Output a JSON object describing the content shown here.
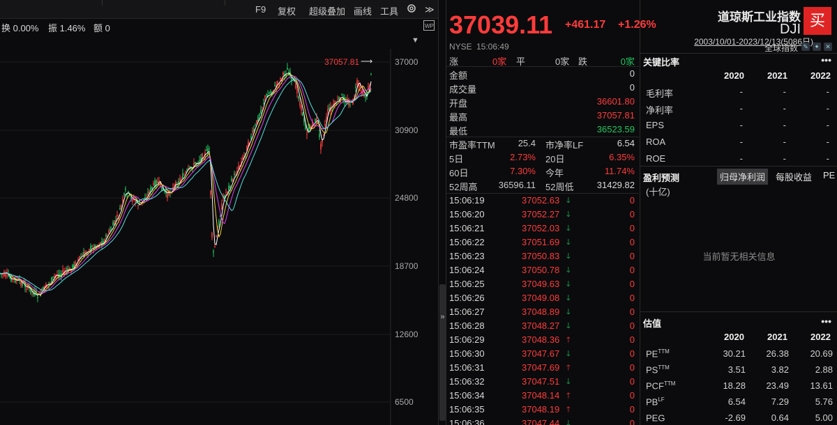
{
  "toolbar": {
    "f9": "F9",
    "fuquan": "复权",
    "overlay": "超级叠加",
    "draw": "画线",
    "tools": "工具",
    "expand": "≫"
  },
  "info": {
    "turnover": "换 0.00%",
    "amplitude": "振 1.46%",
    "amount": "额 0"
  },
  "chart": {
    "range_label": "2003/10/01-2023/12/13(5086日)",
    "y_ticks": [
      "37000",
      "30900",
      "24800",
      "18700",
      "12600",
      "6500"
    ],
    "high_label": "37057.81",
    "colors": {
      "up": "#ff3b3b",
      "down": "#22c55e",
      "ma5": "#ffffff",
      "ma10": "#f3d03a",
      "ma20": "#e040fb",
      "ma30": "#56e0e0"
    }
  },
  "quote": {
    "price": "37039.11",
    "change": "+461.17",
    "change_pct": "+1.26%",
    "exchange": "NYSE",
    "time": "15:06:49",
    "breadth": {
      "up_label": "涨",
      "up": "0家",
      "flat_label": "平",
      "flat": "0家",
      "down_label": "跌",
      "down": "0家"
    },
    "stats": [
      {
        "label": "金额",
        "value": "0",
        "color": "white"
      },
      {
        "label": "成交量",
        "value": "0",
        "color": "white"
      },
      {
        "label": "开盘",
        "value": "36601.80",
        "color": "red"
      },
      {
        "label": "最高",
        "value": "37057.81",
        "color": "red"
      },
      {
        "label": "最低",
        "value": "36523.59",
        "color": "green"
      }
    ],
    "ratios": [
      {
        "l1": "市盈率TTM",
        "v1": "25.4",
        "l2": "市净率LF",
        "v2": "6.54",
        "c1": "white",
        "c2": "white"
      },
      {
        "l1": "5日",
        "v1": "2.73%",
        "l2": "20日",
        "v2": "6.35%",
        "c1": "red",
        "c2": "red"
      },
      {
        "l1": "60日",
        "v1": "7.30%",
        "l2": "今年",
        "v2": "11.74%",
        "c1": "red",
        "c2": "red"
      },
      {
        "l1": "52周高",
        "v1": "36596.11",
        "l2": "52周低",
        "v2": "31429.82",
        "c1": "white",
        "c2": "white"
      }
    ],
    "ticks": [
      {
        "t": "15:06:19",
        "p": "37052.63",
        "d": "down",
        "v": "0"
      },
      {
        "t": "15:06:20",
        "p": "37052.27",
        "d": "down",
        "v": "0"
      },
      {
        "t": "15:06:21",
        "p": "37052.03",
        "d": "down",
        "v": "0"
      },
      {
        "t": "15:06:22",
        "p": "37051.69",
        "d": "down",
        "v": "0"
      },
      {
        "t": "15:06:23",
        "p": "37050.83",
        "d": "down",
        "v": "0"
      },
      {
        "t": "15:06:24",
        "p": "37050.78",
        "d": "down",
        "v": "0"
      },
      {
        "t": "15:06:25",
        "p": "37049.63",
        "d": "down",
        "v": "0"
      },
      {
        "t": "15:06:26",
        "p": "37049.08",
        "d": "down",
        "v": "0"
      },
      {
        "t": "15:06:27",
        "p": "37048.89",
        "d": "down",
        "v": "0"
      },
      {
        "t": "15:06:28",
        "p": "37048.27",
        "d": "down",
        "v": "0"
      },
      {
        "t": "15:06:29",
        "p": "37048.36",
        "d": "up",
        "v": "0"
      },
      {
        "t": "15:06:30",
        "p": "37047.67",
        "d": "down",
        "v": "0"
      },
      {
        "t": "15:06:31",
        "p": "37047.69",
        "d": "up",
        "v": "0"
      },
      {
        "t": "15:06:32",
        "p": "37047.51",
        "d": "down",
        "v": "0"
      },
      {
        "t": "15:06:34",
        "p": "37048.14",
        "d": "up",
        "v": "0"
      },
      {
        "t": "15:06:35",
        "p": "37048.19",
        "d": "up",
        "v": "0"
      },
      {
        "t": "15:06:36",
        "p": "37047.44",
        "d": "down",
        "v": "0"
      }
    ]
  },
  "right": {
    "name": "道琼斯工业指数",
    "code": "DJI",
    "buy": "买",
    "global": "全球指数",
    "key_ratios": {
      "title": "关键比率",
      "years": [
        "2020",
        "2021",
        "2022"
      ],
      "rows": [
        {
          "label": "毛利率",
          "vals": [
            "-",
            "-",
            "-"
          ]
        },
        {
          "label": "净利率",
          "vals": [
            "-",
            "-",
            "-"
          ]
        },
        {
          "label": "EPS",
          "vals": [
            "-",
            "-",
            "-"
          ]
        },
        {
          "label": "ROA",
          "vals": [
            "-",
            "-",
            "-"
          ]
        },
        {
          "label": "ROE",
          "vals": [
            "-",
            "-",
            "-"
          ]
        }
      ]
    },
    "forecast": {
      "title": "盈利预测",
      "tabs": [
        "归母净利润",
        "每股收益",
        "PE"
      ],
      "unit": "(十亿)",
      "empty": "当前暂无相关信息"
    },
    "valuation": {
      "title": "估值",
      "years": [
        "2020",
        "2021",
        "2022"
      ],
      "rows": [
        {
          "label": "PE",
          "sup": "TTM",
          "vals": [
            "30.21",
            "26.38",
            "20.69"
          ]
        },
        {
          "label": "PS",
          "sup": "TTM",
          "vals": [
            "3.51",
            "3.82",
            "2.88"
          ]
        },
        {
          "label": "PCF",
          "sup": "TTM",
          "vals": [
            "18.28",
            "23.49",
            "13.61"
          ]
        },
        {
          "label": "PB",
          "sup": "LF",
          "vals": [
            "6.54",
            "7.29",
            "5.76"
          ]
        },
        {
          "label": "PEG",
          "sup": "",
          "vals": [
            "-2.69",
            "0.64",
            "5.00"
          ]
        }
      ]
    }
  }
}
